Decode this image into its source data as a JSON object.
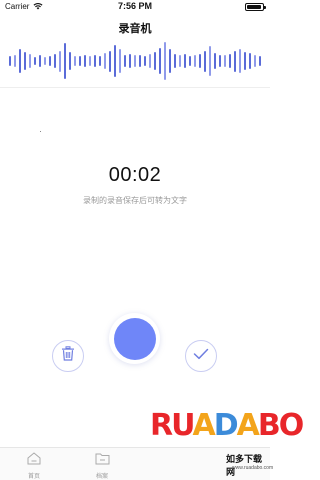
{
  "status_bar": {
    "carrier": "Carrier",
    "time": "7:56 PM",
    "wifi_icon": "wifi-icon",
    "battery_icon": "battery-icon"
  },
  "header": {
    "title": "录音机"
  },
  "waveform": {
    "colors": {
      "primary": "#5a6bd8",
      "secondary": "#8f9aea"
    },
    "levels": [
      0.25,
      0.3,
      0.55,
      0.45,
      0.35,
      0.2,
      0.28,
      0.2,
      0.25,
      0.35,
      0.5,
      0.85,
      0.45,
      0.25,
      0.22,
      0.3,
      0.22,
      0.3,
      0.22,
      0.4,
      0.5,
      0.75,
      0.55,
      0.3,
      0.35,
      0.28,
      0.3,
      0.25,
      0.35,
      0.45,
      0.6,
      0.9,
      0.55,
      0.35,
      0.3,
      0.35,
      0.25,
      0.3,
      0.35,
      0.5,
      0.7,
      0.4,
      0.3,
      0.28,
      0.35,
      0.5,
      0.55,
      0.45,
      0.4,
      0.3,
      0.25
    ]
  },
  "recorder": {
    "timer": "00:02",
    "hint": "录制的录音保存后可转为文字",
    "delete_icon": "trash-icon",
    "confirm_icon": "checkmark-icon",
    "record_color": "#6f86f8"
  },
  "tab_bar": {
    "tabs": [
      {
        "label": "首页",
        "icon": "home-icon"
      },
      {
        "label": "档案",
        "icon": "folder-icon"
      }
    ]
  },
  "watermark": {
    "logo_parts": [
      "RU",
      "A",
      "D",
      "A",
      "BO"
    ],
    "tagline": "如多下载网",
    "url": "www.ruadabo.com"
  }
}
